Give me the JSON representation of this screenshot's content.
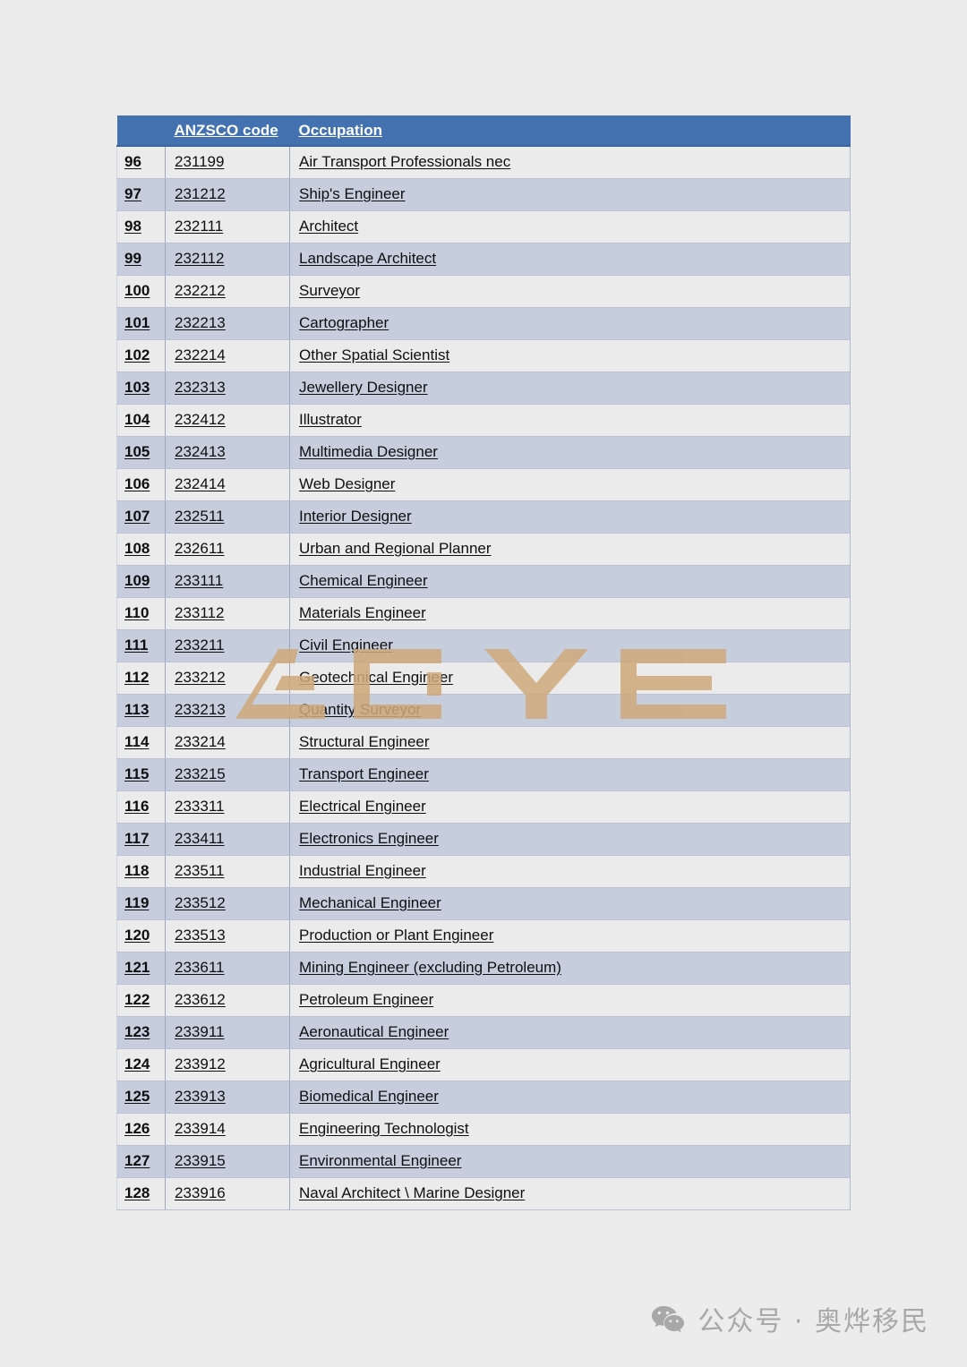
{
  "document": {
    "background_color": "#ececec",
    "table": {
      "header_color": "#4472b0",
      "row_color_light": "#ebebeb",
      "row_color_blue": "#c6cede",
      "columns": [
        {
          "key": "index",
          "label": ""
        },
        {
          "key": "code",
          "label": "ANZSCO code"
        },
        {
          "key": "occupation",
          "label": "Occupation"
        }
      ],
      "rows": [
        {
          "index": "96",
          "code": "231199",
          "occupation": "Air Transport Professionals nec"
        },
        {
          "index": "97",
          "code": "231212",
          "occupation": "Ship's Engineer"
        },
        {
          "index": "98",
          "code": "232111",
          "occupation": "Architect"
        },
        {
          "index": "99",
          "code": "232112",
          "occupation": "Landscape Architect"
        },
        {
          "index": "100",
          "code": "232212",
          "occupation": "Surveyor"
        },
        {
          "index": "101",
          "code": "232213",
          "occupation": "Cartographer"
        },
        {
          "index": "102",
          "code": "232214",
          "occupation": "Other Spatial Scientist"
        },
        {
          "index": "103",
          "code": "232313",
          "occupation": "Jewellery Designer"
        },
        {
          "index": "104",
          "code": "232412",
          "occupation": "Illustrator"
        },
        {
          "index": "105",
          "code": "232413",
          "occupation": "Multimedia Designer"
        },
        {
          "index": "106",
          "code": "232414",
          "occupation": "Web Designer"
        },
        {
          "index": "107",
          "code": "232511",
          "occupation": "Interior Designer"
        },
        {
          "index": "108",
          "code": "232611",
          "occupation": "Urban and Regional Planner"
        },
        {
          "index": "109",
          "code": "233111",
          "occupation": "Chemical Engineer"
        },
        {
          "index": "110",
          "code": "233112",
          "occupation": "Materials Engineer"
        },
        {
          "index": "111",
          "code": "233211",
          "occupation": "Civil Engineer"
        },
        {
          "index": "112",
          "code": "233212",
          "occupation": "Geotechnical Engineer"
        },
        {
          "index": "113",
          "code": "233213",
          "occupation": "Quantity Surveyor"
        },
        {
          "index": "114",
          "code": "233214",
          "occupation": "Structural Engineer"
        },
        {
          "index": "115",
          "code": "233215",
          "occupation": "Transport Engineer"
        },
        {
          "index": "116",
          "code": "233311",
          "occupation": "Electrical Engineer"
        },
        {
          "index": "117",
          "code": "233411",
          "occupation": "Electronics Engineer"
        },
        {
          "index": "118",
          "code": "233511",
          "occupation": "Industrial Engineer"
        },
        {
          "index": "119",
          "code": "233512",
          "occupation": "Mechanical Engineer"
        },
        {
          "index": "120",
          "code": "233513",
          "occupation": "Production or Plant Engineer"
        },
        {
          "index": "121",
          "code": "233611",
          "occupation": "Mining Engineer (excluding Petroleum)"
        },
        {
          "index": "122",
          "code": "233612",
          "occupation": "Petroleum Engineer"
        },
        {
          "index": "123",
          "code": "233911",
          "occupation": "Aeronautical Engineer"
        },
        {
          "index": "124",
          "code": "233912",
          "occupation": "Agricultural Engineer"
        },
        {
          "index": "125",
          "code": "233913",
          "occupation": "Biomedical Engineer"
        },
        {
          "index": "126",
          "code": "233914",
          "occupation": "Engineering Technologist"
        },
        {
          "index": "127",
          "code": "233915",
          "occupation": "Environmental Engineer"
        },
        {
          "index": "128",
          "code": "233916",
          "occupation": "Naval Architect \\ Marine Designer"
        }
      ]
    }
  },
  "watermark": {
    "text": "AOYE",
    "color": "#cfa97a"
  },
  "footer": {
    "icon": "wechat-icon",
    "credit": "公众号 · 奥烨移民",
    "color": "#a8a8a8"
  }
}
